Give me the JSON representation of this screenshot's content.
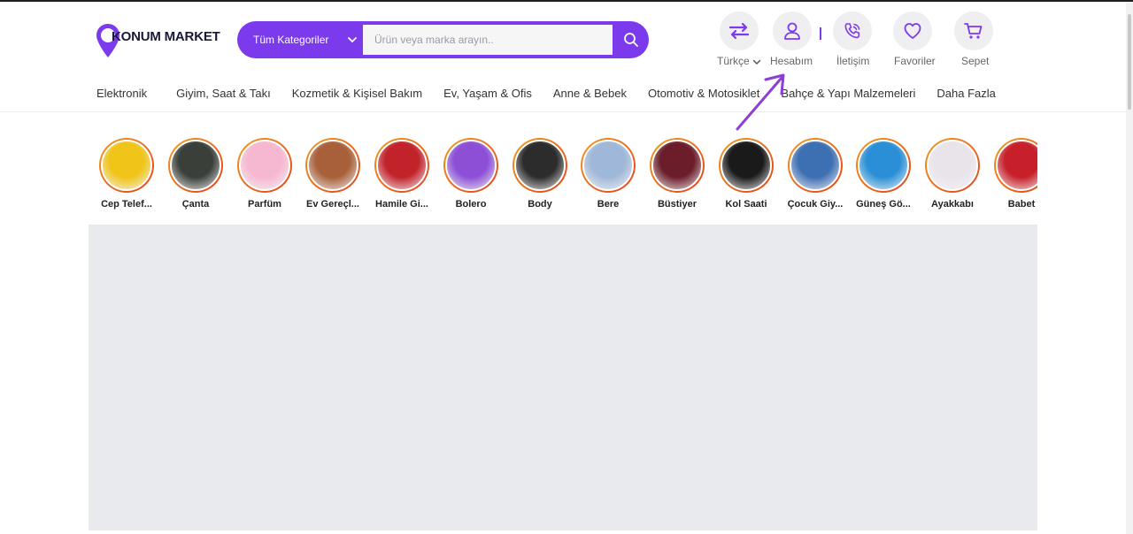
{
  "brand": {
    "name": "KONUM MARKET",
    "accent": "#7c3aed"
  },
  "search": {
    "category_label": "Tüm Kategoriler",
    "placeholder": "Ürün veya marka arayın.."
  },
  "header": {
    "language": "Türkçe",
    "account": "Hesabım",
    "contact": "İletişim",
    "favorites": "Favoriler",
    "cart": "Sepet"
  },
  "nav": [
    "Elektronik",
    "Giyim, Saat & Takı",
    "Kozmetik & Kişisel Bakım",
    "Ev, Yaşam & Ofis",
    "Anne & Bebek",
    "Otomotiv & Motosiklet",
    "Bahçe & Yapı Malzemeleri",
    "Daha Fazla"
  ],
  "categories": [
    {
      "label": "Cep Telef...",
      "color": "#f0c419"
    },
    {
      "label": "Çanta",
      "color": "#3a3f3a"
    },
    {
      "label": "Parfüm",
      "color": "#f6b7d0"
    },
    {
      "label": "Ev Gereçl...",
      "color": "#a8603a"
    },
    {
      "label": "Hamile Gi...",
      "color": "#c2232b"
    },
    {
      "label": "Bolero",
      "color": "#8c4fd6"
    },
    {
      "label": "Body",
      "color": "#2c2c2c"
    },
    {
      "label": "Bere",
      "color": "#9fb7d8"
    },
    {
      "label": "Büstiyer",
      "color": "#6b1d2a"
    },
    {
      "label": "Kol Saati",
      "color": "#1a1a1a"
    },
    {
      "label": "Çocuk Giy...",
      "color": "#3d6fb3"
    },
    {
      "label": "Güneş Gö...",
      "color": "#2a8fd6"
    },
    {
      "label": "Ayakkabı",
      "color": "#e9e3ea"
    },
    {
      "label": "Babet",
      "color": "#c8202a"
    }
  ]
}
